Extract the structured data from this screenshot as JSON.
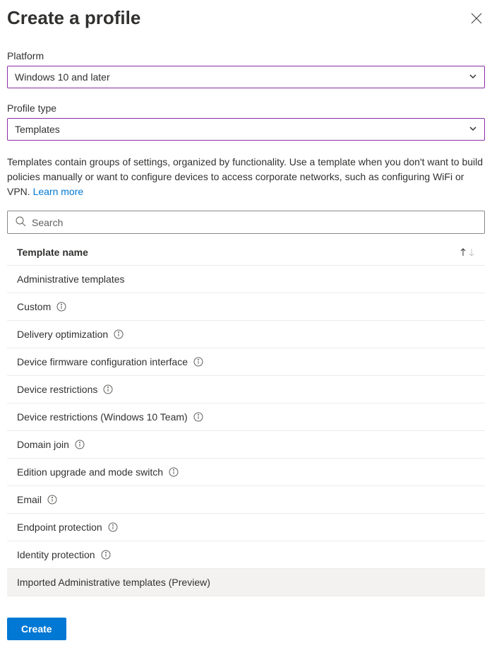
{
  "title": "Create a profile",
  "platform": {
    "label": "Platform",
    "value": "Windows 10 and later"
  },
  "profile_type": {
    "label": "Profile type",
    "value": "Templates"
  },
  "description": "Templates contain groups of settings, organized by functionality. Use a template when you don't want to build policies manually or want to configure devices to access corporate networks, such as configuring WiFi or VPN. ",
  "learn_more": "Learn more",
  "search": {
    "placeholder": "Search"
  },
  "table": {
    "column_header": "Template name"
  },
  "templates": [
    {
      "name": "Administrative templates",
      "has_info": false,
      "highlighted": false
    },
    {
      "name": "Custom",
      "has_info": true,
      "highlighted": false
    },
    {
      "name": "Delivery optimization",
      "has_info": true,
      "highlighted": false
    },
    {
      "name": "Device firmware configuration interface",
      "has_info": true,
      "highlighted": false
    },
    {
      "name": "Device restrictions",
      "has_info": true,
      "highlighted": false
    },
    {
      "name": "Device restrictions (Windows 10 Team)",
      "has_info": true,
      "highlighted": false
    },
    {
      "name": "Domain join",
      "has_info": true,
      "highlighted": false
    },
    {
      "name": "Edition upgrade and mode switch",
      "has_info": true,
      "highlighted": false
    },
    {
      "name": "Email",
      "has_info": true,
      "highlighted": false
    },
    {
      "name": "Endpoint protection",
      "has_info": true,
      "highlighted": false
    },
    {
      "name": "Identity protection",
      "has_info": true,
      "highlighted": false
    },
    {
      "name": "Imported Administrative templates (Preview)",
      "has_info": false,
      "highlighted": true
    }
  ],
  "create_button": "Create"
}
